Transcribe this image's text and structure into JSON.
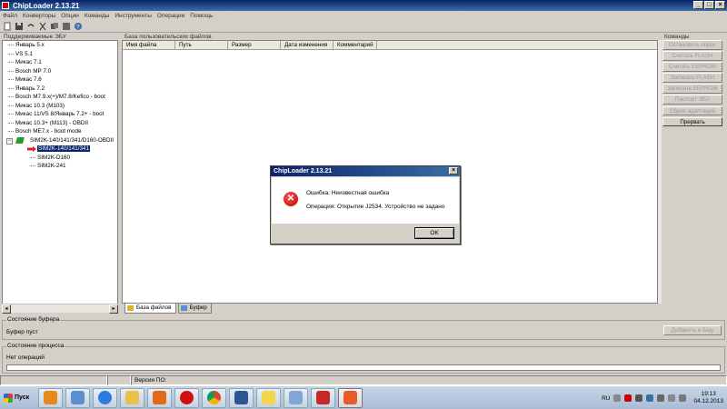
{
  "window": {
    "title": "ChipLoader 2.13.21"
  },
  "menu": [
    "Файл",
    "Конверторы",
    "Опции",
    "Команды",
    "Инструменты",
    "Операции",
    "Помощь"
  ],
  "tree": {
    "header": "Поддерживаемые ЭБУ",
    "items": [
      "Январь 5.x",
      "VS 5.1",
      "Микас 7.1",
      "Bosch MP 7.0",
      "Микас 7.6",
      "Январь 7.2",
      "Bosch M7.9.x(+)/M7.8/Kefico - boot",
      "Микас 10.3 (M103)",
      "Микас 11/VS 8/Январь 7.2+ - boot",
      "Микас 10.3+ (M113) - OBDII",
      "Bosch ME7.x - boot mode"
    ],
    "open_node": "SIM2K-140/141/341/D160-OBDII",
    "children": [
      "SIM2K-140/141/341",
      "SIM2K-D160",
      "SIM2K-241"
    ]
  },
  "files": {
    "header": "База пользовательских файлов",
    "columns": [
      "Имя файла",
      "Путь",
      "Размер",
      "Дата изменения",
      "Комментарий"
    ],
    "tabs": [
      "База файлов",
      "Буфер"
    ]
  },
  "commands": {
    "header": "Команды",
    "buttons": [
      "Остановить опрос",
      "Считать FLASH",
      "Считать EEPROM",
      "Записать FLASH",
      "Записать EEPROM",
      "Паспорт ЭБУ",
      "Сброс адаптаций",
      "Прервать"
    ]
  },
  "buffer": {
    "label": "Состояние буфера",
    "status": "Буфер пуст",
    "add_button": "Добавить в базу"
  },
  "process": {
    "label": "Состояние процесса",
    "status": "Нет операций"
  },
  "statusbar": {
    "version_label": "Версия ПО:"
  },
  "dialog": {
    "title": "ChipLoader 2.13.21",
    "line1": "Ошибка: Неизвестная ошибка",
    "line2": "Операция: Открытие J2534. Устройство не задано",
    "ok": "OK"
  },
  "taskbar": {
    "start": "Пуск",
    "lang": "RU",
    "time": "19:13",
    "date": "04.12.2013"
  },
  "colors": {
    "accent": "#0a246a",
    "error": "#cc0000"
  }
}
